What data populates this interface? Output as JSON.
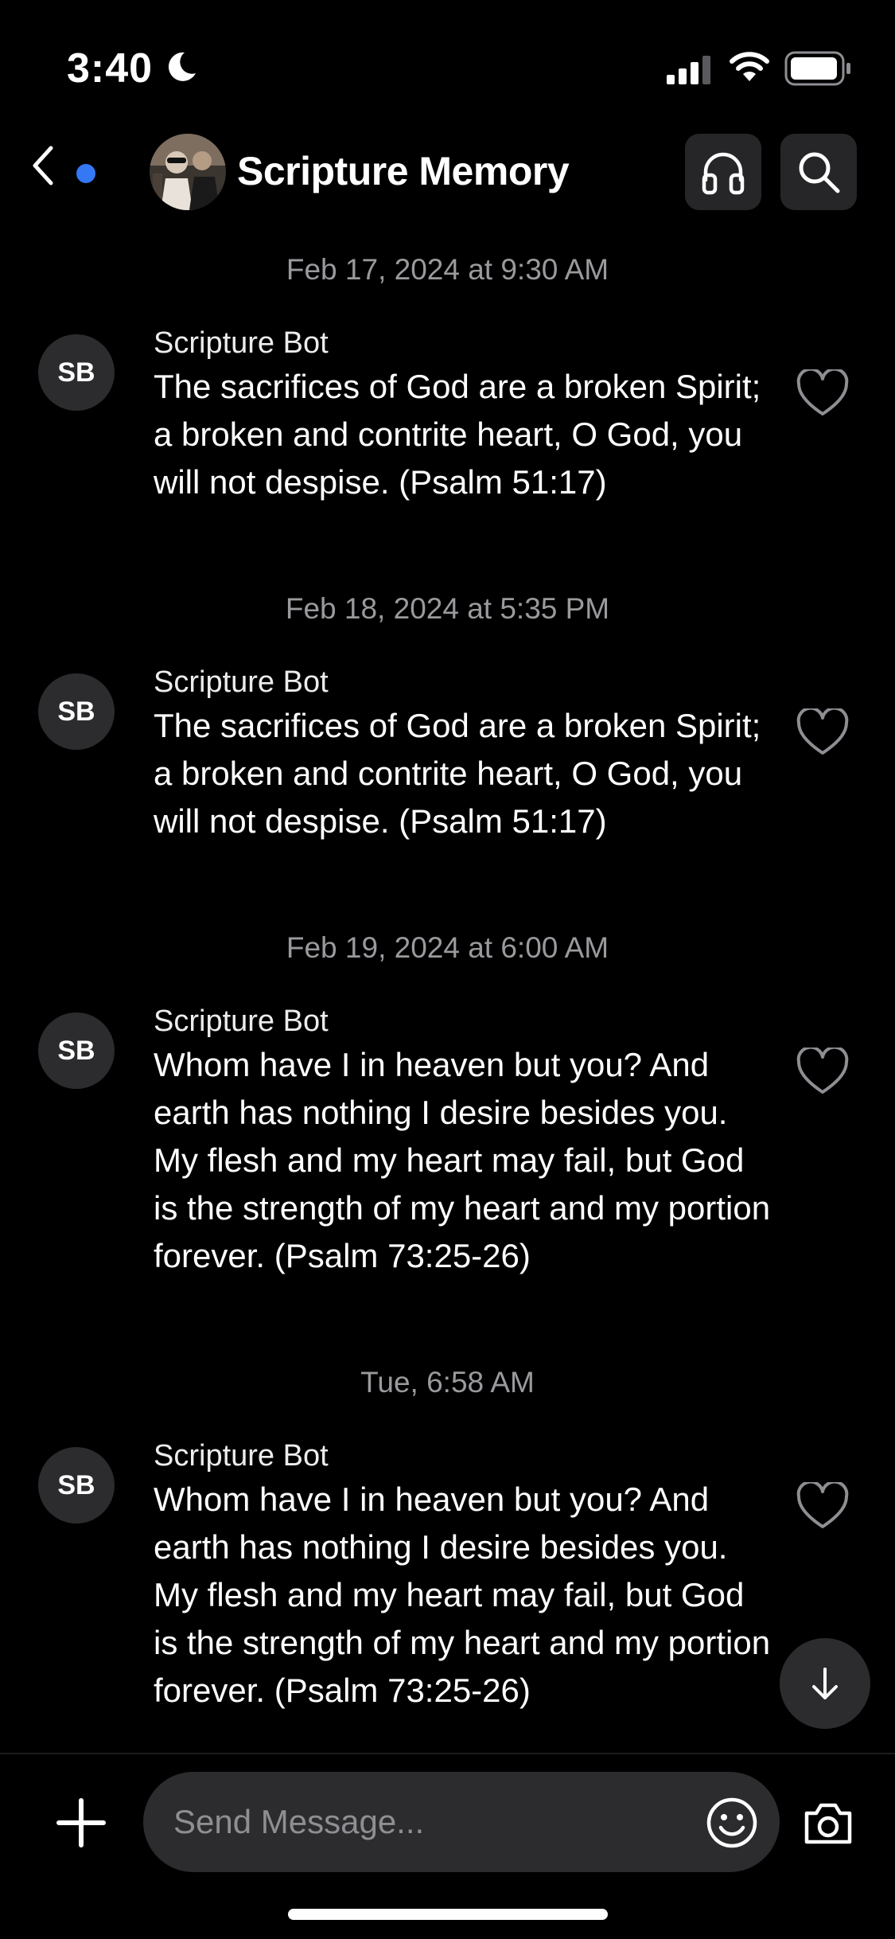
{
  "status_bar": {
    "time": "3:40"
  },
  "header": {
    "title": "Scripture Memory"
  },
  "messages": [
    {
      "timestamp": "Feb 17, 2024 at 9:30 AM",
      "avatar": "SB",
      "sender": "Scripture Bot",
      "text": "The sacrifices of God are a broken Spirit; a broken and contrite heart, O God, you will not despise. (Psalm 51:17)"
    },
    {
      "timestamp": "Feb 18, 2024 at 5:35 PM",
      "avatar": "SB",
      "sender": "Scripture Bot",
      "text": "The sacrifices of God are a broken Spirit; a broken and contrite heart, O God, you will not despise. (Psalm 51:17)"
    },
    {
      "timestamp": "Feb 19, 2024 at 6:00 AM",
      "avatar": "SB",
      "sender": "Scripture Bot",
      "text": "Whom have I in heaven but you? And earth has nothing I desire besides you. My flesh and my heart may fail, but God is the strength of my heart and my portion forever. (Psalm 73:25-26)"
    },
    {
      "timestamp": "Tue, 6:58 AM",
      "avatar": "SB",
      "sender": "Scripture Bot",
      "text": "Whom have I in heaven but you? And earth has nothing I desire besides you. My flesh and my heart may fail, but God is the strength of my heart and my portion forever. (Psalm 73:25-26)"
    }
  ],
  "composer": {
    "placeholder": "Send Message..."
  },
  "icons": {
    "back": "chevron-left-icon",
    "headphones": "headphones-icon",
    "search": "search-icon",
    "like": "heart-icon",
    "scroll_down": "arrow-down-icon",
    "add": "plus-icon",
    "emoji": "smiley-icon",
    "camera": "camera-icon"
  },
  "colors": {
    "background": "#000000",
    "unread_dot": "#3478f6",
    "bubble": "#2c2c2e"
  }
}
